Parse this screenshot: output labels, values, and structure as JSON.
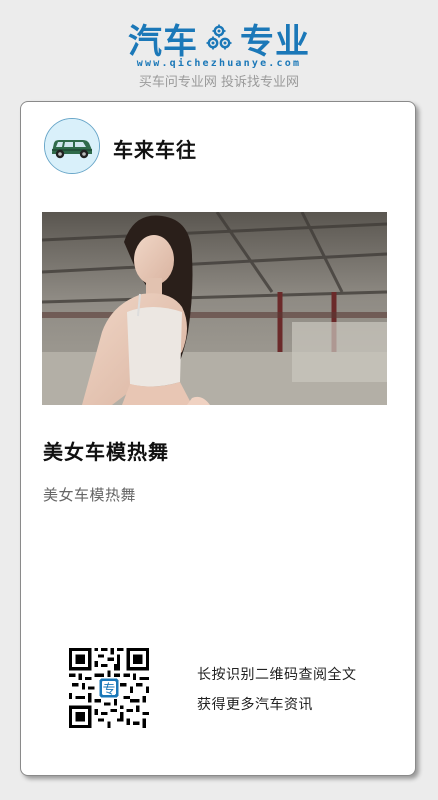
{
  "header": {
    "logo_part1": "汽车",
    "logo_part2": "专业",
    "logo_url": "www.qichezhuanye.com",
    "slogan": "买车问专业网 投诉找专业网",
    "brand_color": "#1b78b8"
  },
  "card": {
    "channel_name": "车来车往",
    "avatar_icon": "car-icon",
    "hero_image": "photo of a woman posing in a warehouse",
    "title": "美女车模热舞",
    "summary": "美女车模热舞",
    "qr_line1": "长按识别二维码查阅全文",
    "qr_line2": "获得更多汽车资讯",
    "qr_center_glyph": "专"
  }
}
